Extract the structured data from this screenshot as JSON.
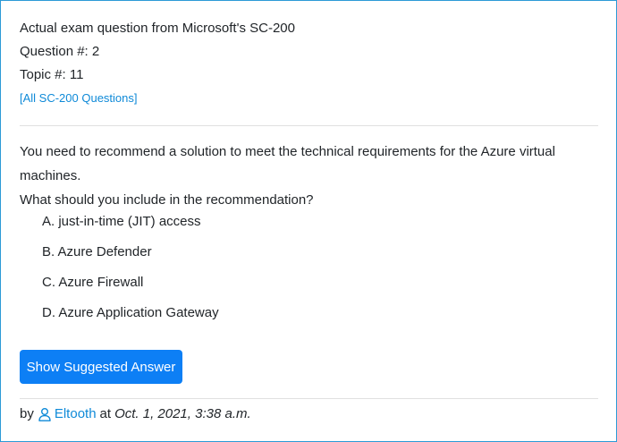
{
  "header": {
    "line1": "Actual exam question from Microsoft's SC-200",
    "question_num": "Question #: 2",
    "topic_num": "Topic #: 11",
    "all_link": "[All SC-200 Questions]"
  },
  "question": {
    "text1": "You need to recommend a solution to meet the technical requirements for the Azure virtual machines.",
    "text2": "What should you include in the recommendation?"
  },
  "choices": [
    "A. just-in-time (JIT) access",
    "B. Azure Defender",
    "C. Azure Firewall",
    "D. Azure Application Gateway"
  ],
  "button": {
    "label": "Show Suggested Answer"
  },
  "footer": {
    "by": "by",
    "user": "Eltooth",
    "at": "at",
    "date": "Oct. 1, 2021, 3:38 a.m."
  },
  "colors": {
    "accent": "#0d7ff5",
    "link": "#0f8ad8",
    "border": "#2c9ad6"
  },
  "icons": {
    "user": "user-icon"
  }
}
